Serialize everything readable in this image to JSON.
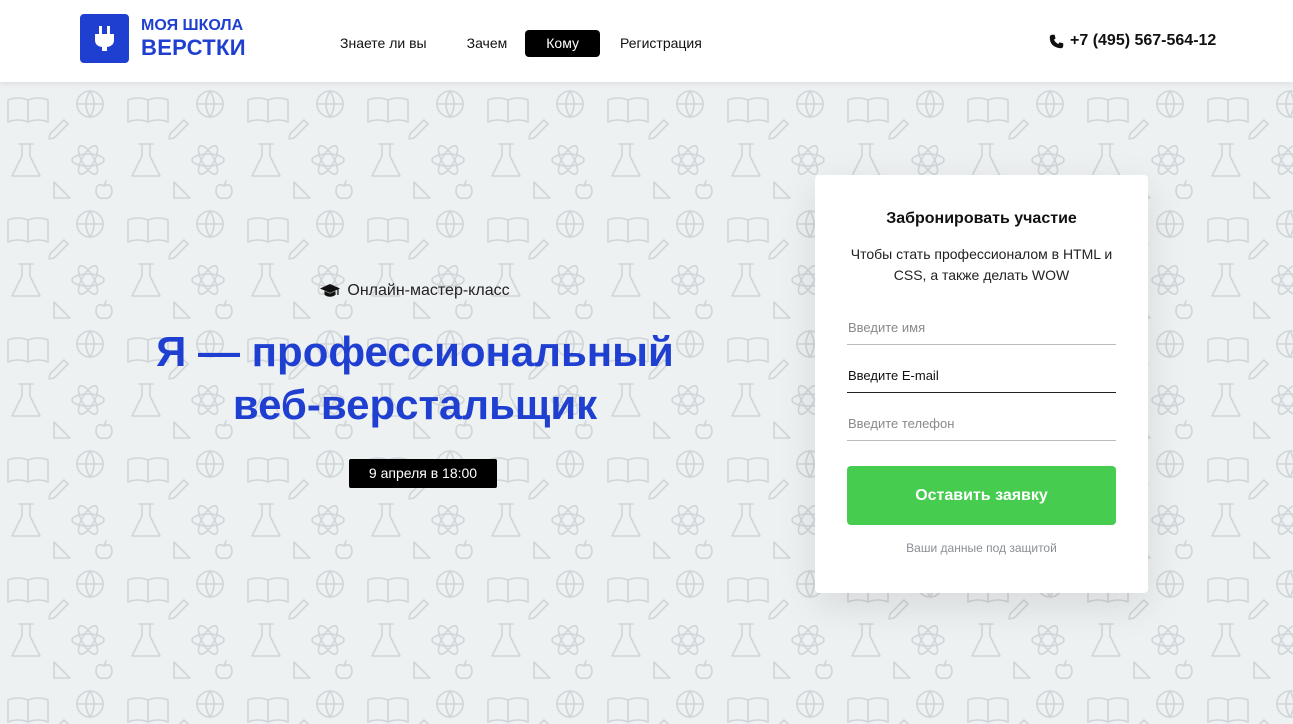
{
  "brand": {
    "line1": "МОЯ ШКОЛА",
    "line2": "ВЕРСТКИ",
    "logo_icon": "plug-icon",
    "accent_color": "#1f3fd1"
  },
  "nav": {
    "items": [
      {
        "label": "Знаете ли вы",
        "active": false
      },
      {
        "label": "Зачем",
        "active": false
      },
      {
        "label": "Кому",
        "active": true
      },
      {
        "label": "Регистрация",
        "active": false
      }
    ]
  },
  "phone": {
    "icon": "phone-icon",
    "number": "+7 (495) 567-564-12"
  },
  "hero": {
    "background_pattern": "school-doodles-pattern",
    "subtitle_icon": "graduation-cap-icon",
    "subtitle": "Онлайн-мастер-класс",
    "title_line1": "Я — профессиональный",
    "title_line2": "веб-верстальщик",
    "date": "9 апреля в 18:00"
  },
  "form": {
    "title": "Забронировать участие",
    "description": "Чтобы стать профессионалом в  HTML и CSS, а также делать WOW",
    "name_placeholder": "Введите имя",
    "email_placeholder": "Введите E-mail",
    "phone_placeholder": "Введите телефон",
    "submit_label": "Оставить заявку",
    "submit_color": "#46cc4f",
    "privacy": "Ваши данные под защитой"
  }
}
